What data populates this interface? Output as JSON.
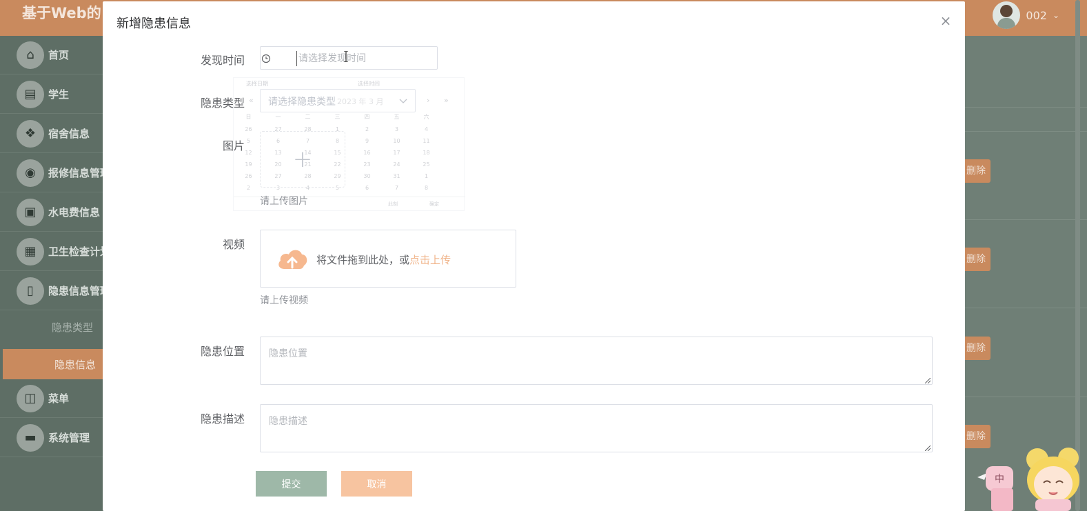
{
  "app": {
    "title": "基于Web的",
    "user": "002"
  },
  "colors": {
    "primary": "#c98a5e",
    "submit": "#9eb8a8",
    "cancel": "#f7c4a0",
    "link": "#f0b48a",
    "cloud": "#f6b88f"
  },
  "sidebar": {
    "items": [
      {
        "label": "首页",
        "icon": "home-icon"
      },
      {
        "label": "学生",
        "icon": "student-icon"
      },
      {
        "label": "宿舍信息",
        "icon": "dorm-icon"
      },
      {
        "label": "报修信息管理",
        "icon": "repair-icon"
      },
      {
        "label": "水电费信息",
        "icon": "briefcase-icon"
      },
      {
        "label": "卫生检查计划",
        "icon": "grid-icon"
      },
      {
        "label": "隐患信息管理",
        "icon": "mouse-icon"
      },
      {
        "label": "菜单",
        "icon": "layout-icon"
      },
      {
        "label": "系统管理",
        "icon": "wallet-icon"
      }
    ],
    "sub_items": [
      {
        "label": "隐患类型",
        "active": false
      },
      {
        "label": "隐患信息",
        "active": true
      }
    ]
  },
  "background": {
    "delete_label": "删除"
  },
  "dialog": {
    "title": "新增隐患信息",
    "fields": {
      "time": {
        "label": "发现时间",
        "placeholder": "请选择发现时间"
      },
      "type": {
        "label": "隐患类型",
        "placeholder": "请选择隐患类型"
      },
      "image": {
        "label": "图片",
        "hint": "请上传图片"
      },
      "video": {
        "label": "视频",
        "drag_text": "将文件拖到此处，或",
        "drag_link": "点击上传",
        "hint": "请上传视频"
      },
      "location": {
        "label": "隐患位置",
        "placeholder": "隐患位置"
      },
      "description": {
        "label": "隐患描述",
        "placeholder": "隐患描述"
      }
    },
    "buttons": {
      "submit": "提交",
      "cancel": "取消"
    }
  },
  "date_picker": {
    "select_date": "选择日期",
    "select_time": "选择时间",
    "year_month": "2023 年 3 月",
    "weekdays": [
      "日",
      "一",
      "二",
      "三",
      "四",
      "五",
      "六"
    ],
    "weeks": [
      [
        "26",
        "27",
        "28",
        "1",
        "2",
        "3",
        "4"
      ],
      [
        "5",
        "6",
        "7",
        "8",
        "9",
        "10",
        "11"
      ],
      [
        "12",
        "13",
        "14",
        "15",
        "16",
        "17",
        "18"
      ],
      [
        "19",
        "20",
        "21",
        "22",
        "23",
        "24",
        "25"
      ],
      [
        "26",
        "27",
        "28",
        "29",
        "30",
        "31",
        "1"
      ],
      [
        "2",
        "3",
        "4",
        "5",
        "6",
        "7",
        "8"
      ]
    ],
    "now": "此刻",
    "confirm": "确定"
  },
  "mascot": {
    "badge": "中"
  }
}
